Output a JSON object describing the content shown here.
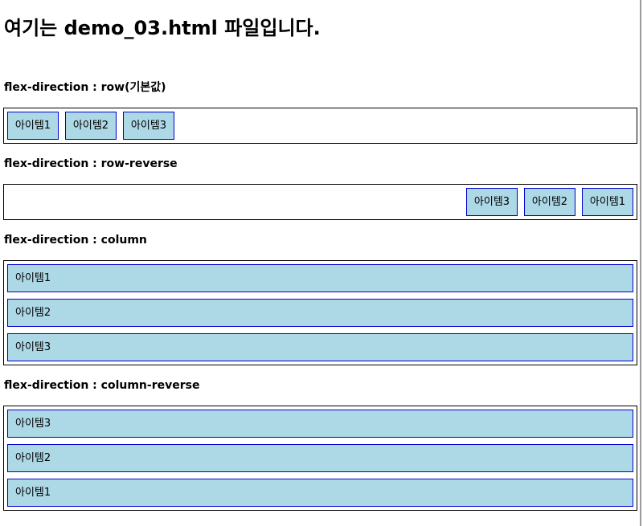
{
  "heading": "여기는 demo_03.html 파일입니다.",
  "sections": [
    {
      "title": "flex-direction : row(기본값)",
      "items": [
        "아이템1",
        "아이템2",
        "아이템3"
      ]
    },
    {
      "title": "flex-direction : row-reverse",
      "items": [
        "아이템1",
        "아이템2",
        "아이템3"
      ]
    },
    {
      "title": "flex-direction : column",
      "items": [
        "아이템1",
        "아이템2",
        "아이템3"
      ]
    },
    {
      "title": "flex-direction : column-reverse",
      "items": [
        "아이템1",
        "아이템2",
        "아이템3"
      ]
    }
  ],
  "colors": {
    "item_background": "#add8e6",
    "item_border": "#0000cd",
    "container_border": "#000000"
  }
}
